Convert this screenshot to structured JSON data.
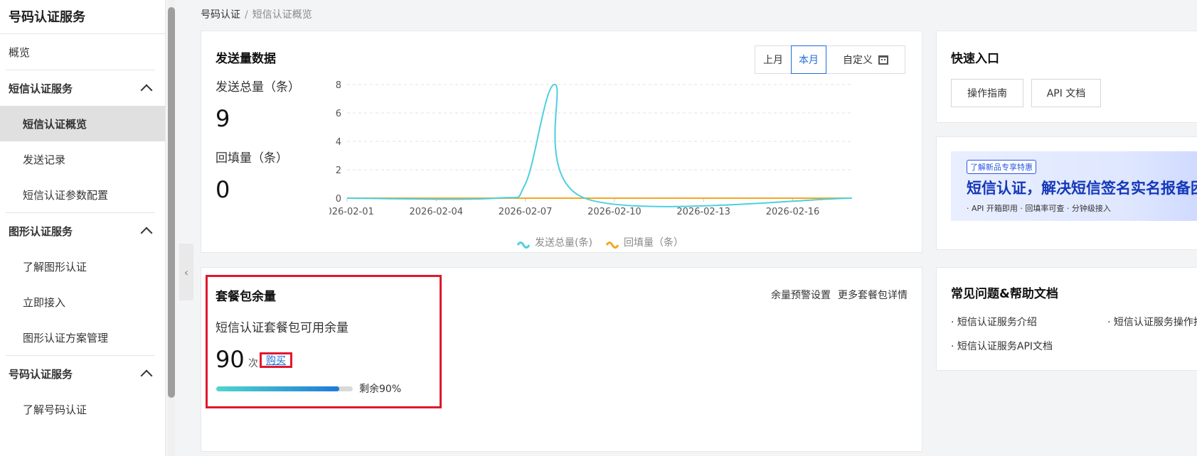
{
  "sidebar": {
    "title": "号码认证服务",
    "overview": "概览",
    "groups": [
      {
        "label": "短信认证服务",
        "items": [
          "短信认证概览",
          "发送记录",
          "短信认证参数配置"
        ],
        "active": 0
      },
      {
        "label": "图形认证服务",
        "items": [
          "了解图形认证",
          "立即接入",
          "图形认证方案管理"
        ]
      },
      {
        "label": "号码认证服务",
        "items": [
          "了解号码认证"
        ]
      }
    ]
  },
  "breadcrumb": {
    "root": "号码认证",
    "sep": "/",
    "current": "短信认证概览"
  },
  "send": {
    "title": "发送量数据",
    "range_tabs": [
      "上月",
      "本月",
      "自定义"
    ],
    "selected_tab": "本月",
    "total_label": "发送总量（条）",
    "total_value": "9",
    "backfill_label": "回填量（条）",
    "backfill_value": "0"
  },
  "chart_data": {
    "type": "line",
    "x_ticks": [
      "2026-02-01",
      "2026-02-04",
      "2026-02-07",
      "2026-02-10",
      "2026-02-13",
      "2026-02-16"
    ],
    "x_range": [
      "2026-02-01",
      "2026-02-18"
    ],
    "y_ticks": [
      "0",
      "2",
      "4",
      "6",
      "8"
    ],
    "ylim": [
      0,
      8
    ],
    "grid": true,
    "legend_placement": "bottom",
    "series": [
      {
        "name": "发送总量(条)",
        "color": "#4dd0de",
        "smooth": true,
        "points": [
          [
            "2026-02-01",
            0
          ],
          [
            "2026-02-06",
            0
          ],
          [
            "2026-02-07",
            1
          ],
          [
            "2026-02-08",
            8
          ],
          [
            "2026-02-09",
            0
          ],
          [
            "2026-02-18",
            0
          ]
        ]
      },
      {
        "name": "回填量（条）",
        "color": "#f5a623",
        "smooth": false,
        "points": [
          [
            "2026-02-01",
            0
          ],
          [
            "2026-02-18",
            0
          ]
        ]
      }
    ]
  },
  "package": {
    "title": "套餐包余量",
    "subtitle": "短信认证套餐包可用余量",
    "remaining": "90",
    "unit": "次",
    "buy_label": "购买",
    "percent_text": "剩余90%",
    "percent_value": 90,
    "links": [
      "余量预警设置",
      "更多套餐包详情"
    ]
  },
  "quick": {
    "title": "快速入口",
    "buttons": [
      "操作指南",
      "API 文档"
    ]
  },
  "banner": {
    "badge": "了解新品专享特惠",
    "headline": "短信认证，解决短信签名实名报备困扰",
    "tags": "· API 开箱即用    · 回填率可查    · 分钟级接入"
  },
  "faq": {
    "title": "常见问题&帮助文档",
    "items": [
      "· 短信认证服务介绍",
      "· 短信认证服务操作指南",
      "· 短信认证服务API文档"
    ]
  },
  "icons": {
    "collapse": "chevron-left-icon",
    "calendar": "calendar-icon",
    "group_toggle": "chevron-up-icon"
  }
}
